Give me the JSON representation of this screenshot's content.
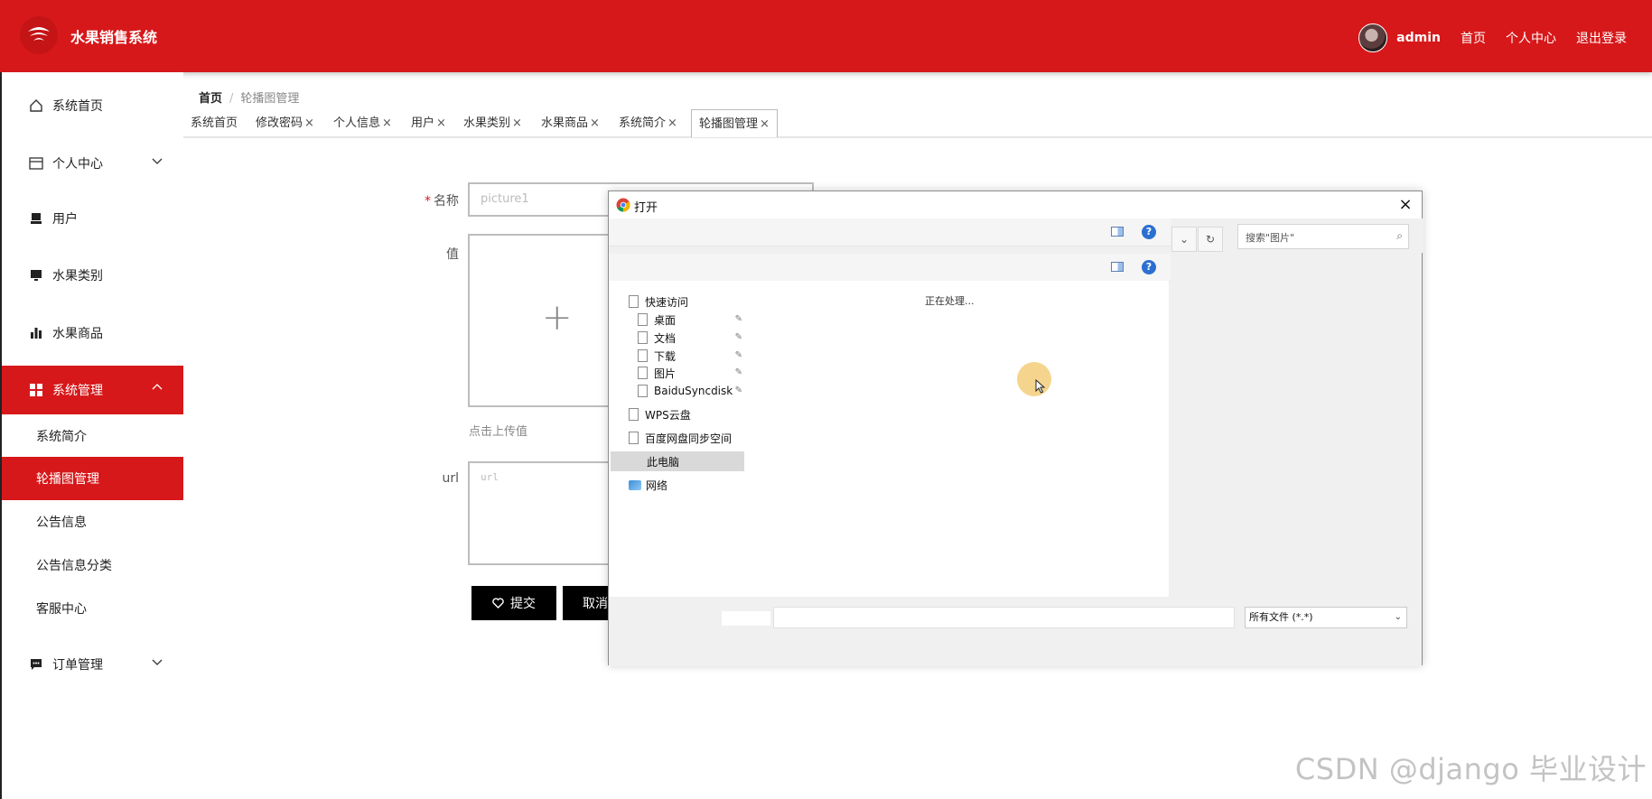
{
  "header": {
    "app_title": "水果销售系统",
    "user": "admin",
    "nav": [
      "首页",
      "个人中心",
      "退出登录"
    ]
  },
  "sidebar": {
    "items": [
      {
        "label": "系统首页",
        "icon": "home-icon"
      },
      {
        "label": "个人中心",
        "icon": "card-icon"
      },
      {
        "label": "用户",
        "icon": "user-icon"
      },
      {
        "label": "水果类别",
        "icon": "monitor-icon"
      },
      {
        "label": "水果商品",
        "icon": "bar-chart-icon"
      },
      {
        "label": "系统管理",
        "icon": "grid-icon"
      },
      {
        "label": "订单管理",
        "icon": "chat-icon"
      }
    ],
    "sub_items": [
      "系统简介",
      "轮播图管理",
      "公告信息",
      "公告信息分类",
      "客服中心"
    ]
  },
  "breadcrumb": {
    "home": "首页",
    "sep": "/",
    "current": "轮播图管理"
  },
  "tabs": [
    "系统首页",
    "修改密码",
    "个人信息",
    "用户",
    "水果类别",
    "水果商品",
    "系统简介",
    "轮播图管理"
  ],
  "tab_close": "×",
  "form": {
    "name_label": "名称",
    "name_value": "picture1",
    "value_label": "值",
    "upload_plus": "+",
    "upload_hint": "点击上传值",
    "url_label": "url",
    "url_placeholder": "url",
    "submit_label": "提交",
    "cancel_label": "取消"
  },
  "dialog": {
    "title": "打开",
    "close": "×",
    "search_placeholder": "搜索\"图片\"",
    "help": "?",
    "nav_items": [
      {
        "label": "快速访问",
        "pinned": false
      },
      {
        "label": "桌面",
        "pinned": true
      },
      {
        "label": "文档",
        "pinned": true
      },
      {
        "label": "下载",
        "pinned": true
      },
      {
        "label": "图片",
        "pinned": true
      },
      {
        "label": "BaiduSyncdisk",
        "pinned": true
      },
      {
        "label": "WPS云盘",
        "pinned": false
      },
      {
        "label": "百度网盘同步空间",
        "pinned": false
      },
      {
        "label": "此电脑",
        "pinned": false
      },
      {
        "label": "网络",
        "pinned": false
      }
    ],
    "processing": "正在处理...",
    "file_filter": "所有文件 (*.*)"
  },
  "watermark": "CSDN @django 毕业设计",
  "colors": {
    "brand": "#d7181a",
    "button": "#000000"
  }
}
